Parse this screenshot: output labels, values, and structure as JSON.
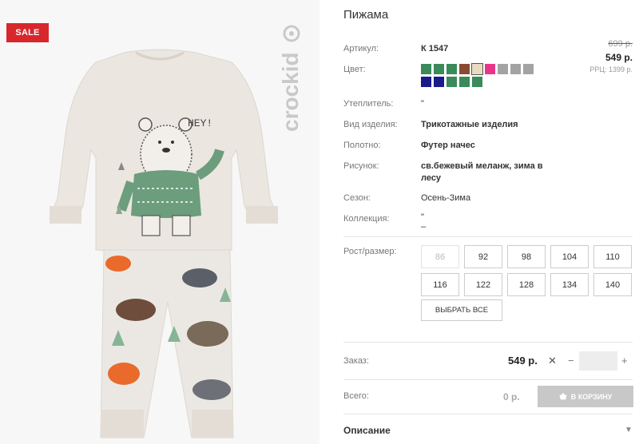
{
  "product": {
    "title": "Пижама",
    "sale_badge": "SALE",
    "logo_text": "crockid"
  },
  "price": {
    "old": "699 р.",
    "current": "549 р.",
    "rrp": "РРЦ: 1399 р."
  },
  "details": {
    "article_label": "Артикул:",
    "article_value": "К 1547",
    "color_label": "Цвет:",
    "insulation_label": "Утеплитель:",
    "insulation_value": "\"",
    "type_label": "Вид изделия:",
    "type_value": "Трикотажные изделия",
    "fabric_label": "Полотно:",
    "fabric_value": "Футер начес",
    "print_label": "Рисунок:",
    "print_value_line1": "св.бежевый меланж, зима в",
    "print_value_line2": "лесу",
    "season_label": "Сезон:",
    "season_value": "Осень-Зима",
    "collection_label": "Коллекция:",
    "collection_value_line1": "\"",
    "collection_value_line2": "–"
  },
  "colors": [
    "#3a8a5a",
    "#3a8a5a",
    "#3a8a5a",
    "#8a4a32",
    "#e8dcc0",
    "#e8358a",
    "#a3a3a3",
    "#a3a3a3",
    "#a3a3a3",
    "#1a1a8a",
    "#1a1a8a",
    "#3a8a5a",
    "#3a8a5a",
    "#3a8a5a"
  ],
  "sizes": {
    "label": "Рост/размер:",
    "options": [
      "86",
      "92",
      "98",
      "104",
      "110",
      "116",
      "122",
      "128",
      "134",
      "140"
    ],
    "select_all": "ВЫБРАТЬ ВСЕ"
  },
  "order": {
    "label": "Заказ:",
    "price": "549 р.",
    "x": "✕",
    "minus": "−",
    "plus": "+",
    "qty": ""
  },
  "total": {
    "label": "Всего:",
    "value": "0 р.",
    "cart_button": "В КОРЗИНУ"
  },
  "description": {
    "title": "Описание"
  }
}
